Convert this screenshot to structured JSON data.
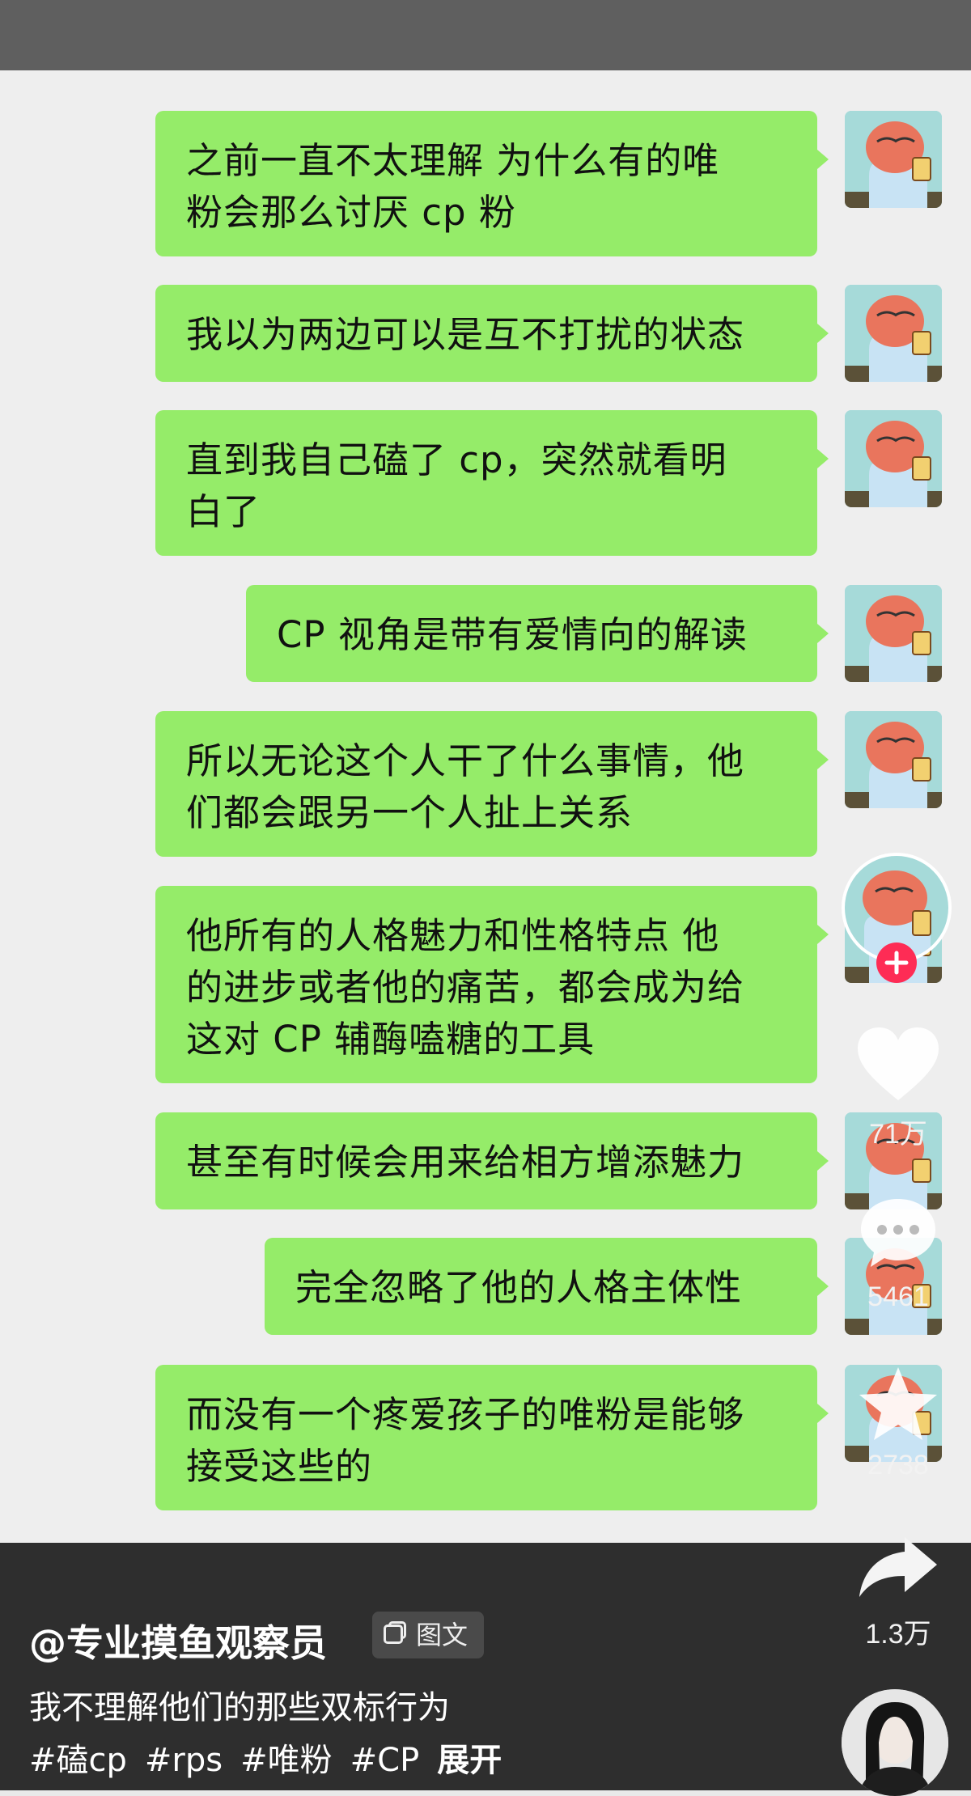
{
  "messages": [
    {
      "lines": [
        "之前一直不太理解 为什么有的唯",
        "粉会那么讨厌 cp 粉"
      ]
    },
    {
      "lines": [
        "我以为两边可以是互不打扰的状态"
      ]
    },
    {
      "lines": [
        "直到我自己磕了 cp，突然就看明",
        "白了"
      ]
    },
    {
      "lines": [
        "CP 视角是带有爱情向的解读"
      ]
    },
    {
      "lines": [
        "所以无论这个人干了什么事情，他",
        "们都会跟另一个人扯上关系"
      ]
    },
    {
      "lines": [
        "他所有的人格魅力和性格特点 他",
        "的进步或者他的痛苦，都会成为给",
        "这对 CP 辅酶嗑糖的工具"
      ]
    },
    {
      "lines": [
        "甚至有时候会用来给相方增添魅力"
      ]
    },
    {
      "lines": [
        "完全忽略了他的人格主体性"
      ]
    },
    {
      "lines": [
        "而没有一个疼爱孩子的唯粉是能够",
        "接受这些的"
      ]
    }
  ],
  "sidebar": {
    "likes": "71万",
    "comments": "5461",
    "favorites": "2738",
    "shares": "1.3万"
  },
  "post": {
    "username": "@专业摸鱼观察员",
    "type_badge": "图文",
    "caption": "我不理解他们的那些双标行为",
    "tags": [
      "#磕cp",
      "#rps",
      "#唯粉",
      "#CP"
    ],
    "expand": "展开"
  },
  "colors": {
    "bubble": "#95ec69",
    "follow_plus": "#fe2c55"
  }
}
